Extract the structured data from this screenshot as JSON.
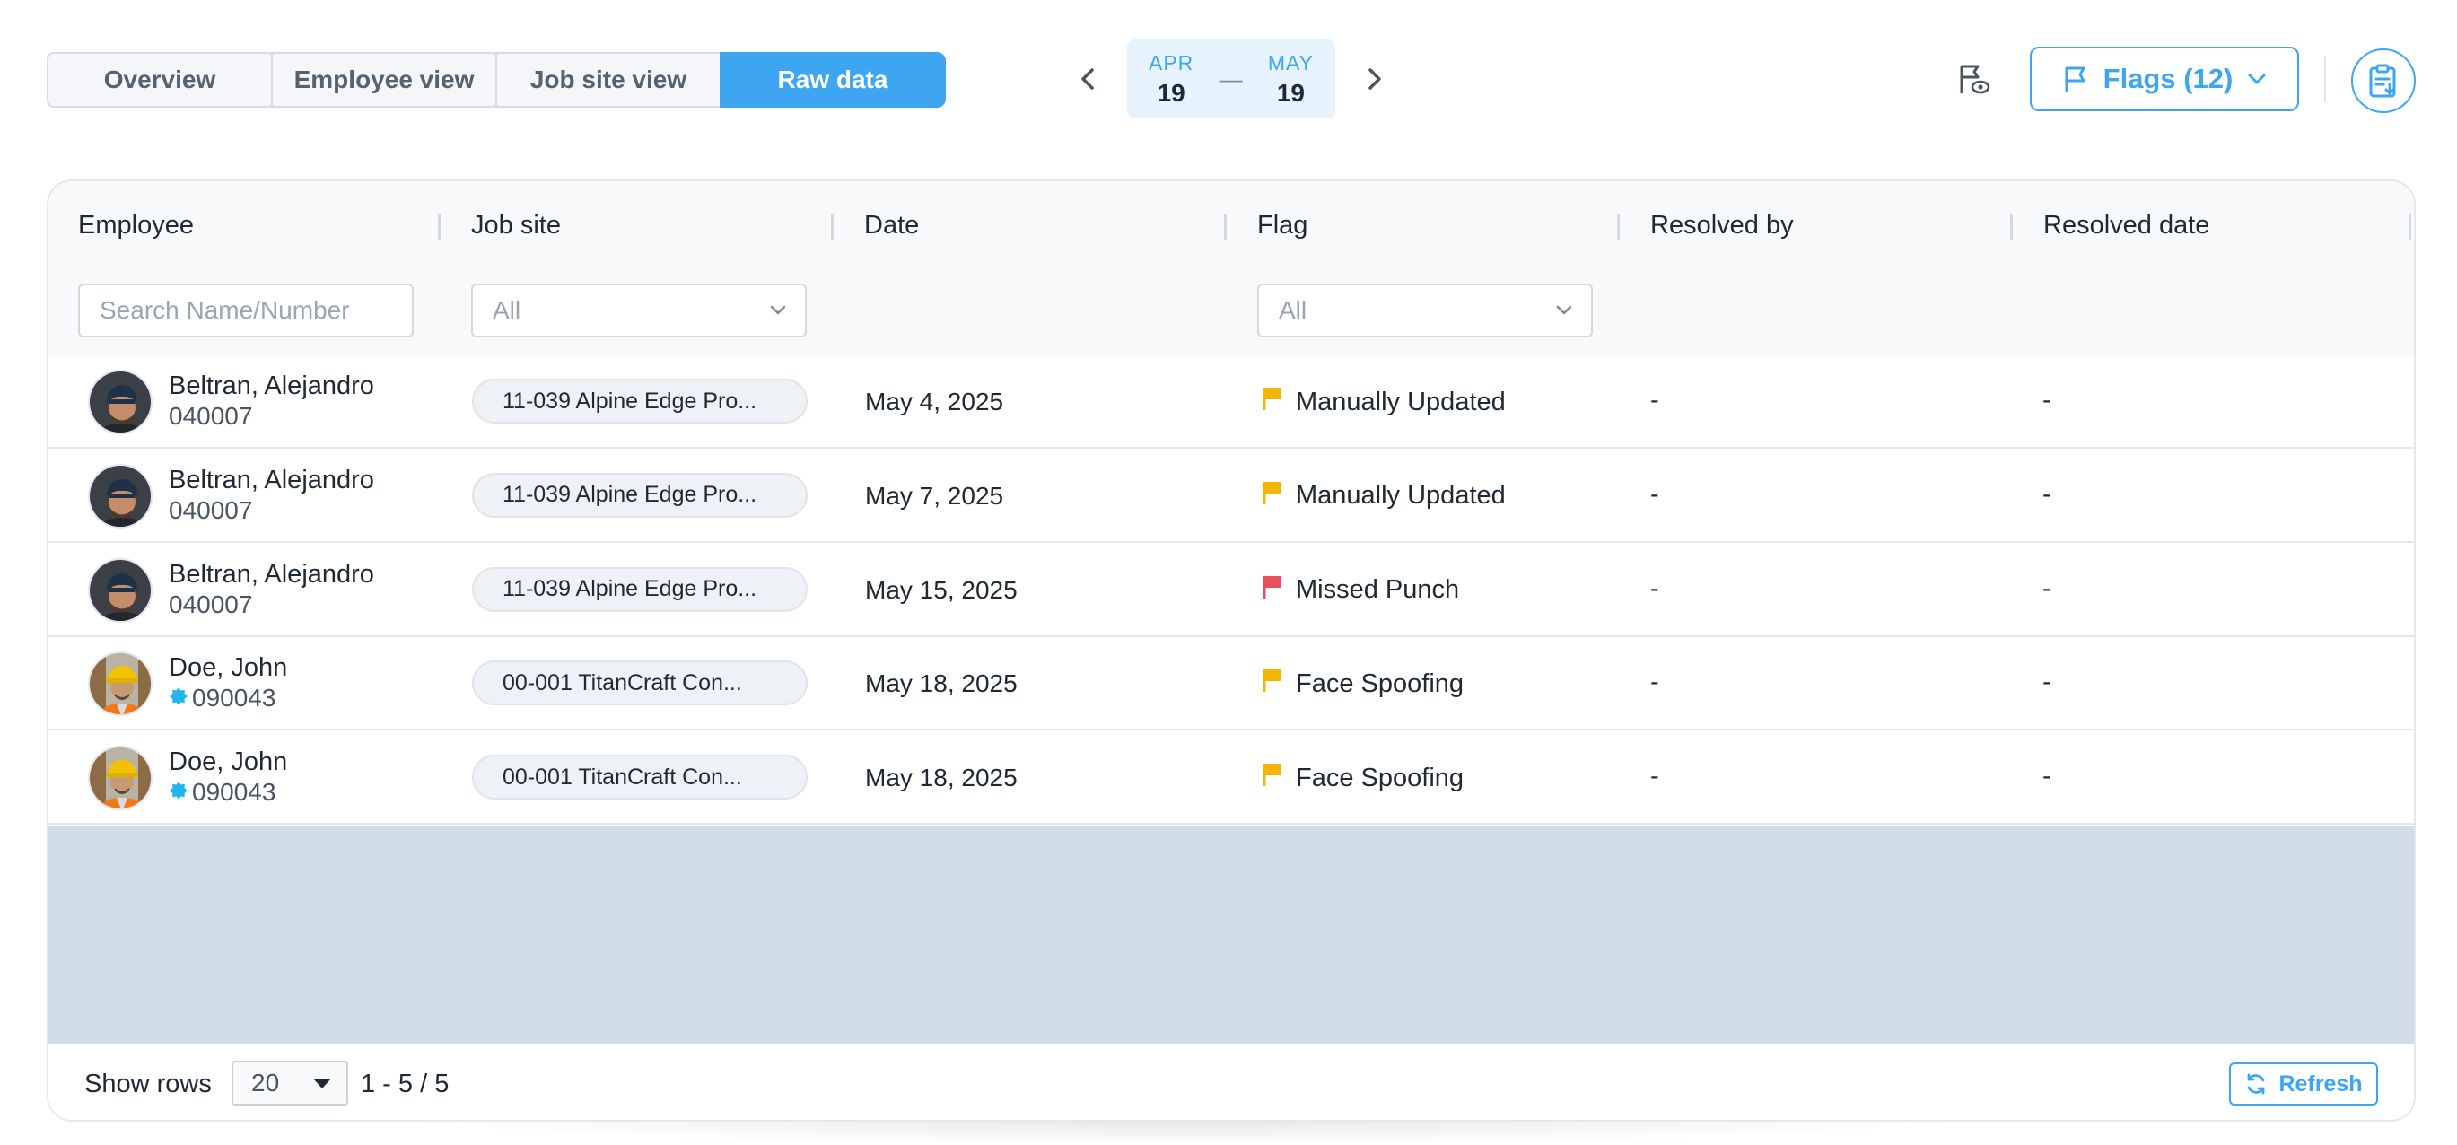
{
  "tabs": [
    {
      "label": "Overview"
    },
    {
      "label": "Employee view"
    },
    {
      "label": "Job site view"
    },
    {
      "label": "Raw data",
      "active": true
    }
  ],
  "date_range": {
    "start_month": "APR",
    "start_day": "19",
    "separator": "—",
    "end_month": "MAY",
    "end_day": "19"
  },
  "flags_button": {
    "label": "Flags (12)"
  },
  "table": {
    "columns": [
      "Employee",
      "Job site",
      "Date",
      "Flag",
      "Resolved by",
      "Resolved date"
    ],
    "filters": {
      "employee_placeholder": "Search Name/Number",
      "job_site_value": "All",
      "flag_value": "All"
    },
    "rows": [
      {
        "name": "Beltran, Alejandro",
        "number": "040007",
        "badge": false,
        "job_site": "11-039 Alpine Edge Pro...",
        "date": "May 4, 2025",
        "flag": "Manually Updated",
        "flag_color": "#f2b705",
        "resolved_by": "-",
        "resolved_date": "-",
        "avatar": "dark-cap"
      },
      {
        "name": "Beltran, Alejandro",
        "number": "040007",
        "badge": false,
        "job_site": "11-039 Alpine Edge Pro...",
        "date": "May 7, 2025",
        "flag": "Manually Updated",
        "flag_color": "#f2b705",
        "resolved_by": "-",
        "resolved_date": "-",
        "avatar": "dark-cap"
      },
      {
        "name": "Beltran, Alejandro",
        "number": "040007",
        "badge": false,
        "job_site": "11-039 Alpine Edge Pro...",
        "date": "May 15, 2025",
        "flag": "Missed Punch",
        "flag_color": "#e8505b",
        "resolved_by": "-",
        "resolved_date": "-",
        "avatar": "dark-cap"
      },
      {
        "name": "Doe, John",
        "number": "090043",
        "badge": true,
        "job_site": "00-001 TitanCraft Con...",
        "date": "May 18, 2025",
        "flag": "Face Spoofing",
        "flag_color": "#f2b705",
        "resolved_by": "-",
        "resolved_date": "-",
        "avatar": "hard-hat"
      },
      {
        "name": "Doe, John",
        "number": "090043",
        "badge": true,
        "job_site": "00-001 TitanCraft Con...",
        "date": "May 18, 2025",
        "flag": "Face Spoofing",
        "flag_color": "#f2b705",
        "resolved_by": "-",
        "resolved_date": "-",
        "avatar": "hard-hat"
      }
    ]
  },
  "pagination": {
    "show_rows_label": "Show rows",
    "rows_per_page": "20",
    "range": "1 - 5 / 5"
  },
  "refresh_button": {
    "label": "Refresh"
  },
  "colors": {
    "accent": "#3ea5f1",
    "empty_area": "#d0dde8",
    "badge": "#1fb6f0"
  },
  "icons": [
    "chevron-left-icon",
    "chevron-right-icon",
    "flag-eye-icon",
    "flag-icon",
    "chevron-down-icon",
    "clipboard-export-icon",
    "refresh-icon",
    "verified-badge-icon",
    "caret-down-icon"
  ]
}
